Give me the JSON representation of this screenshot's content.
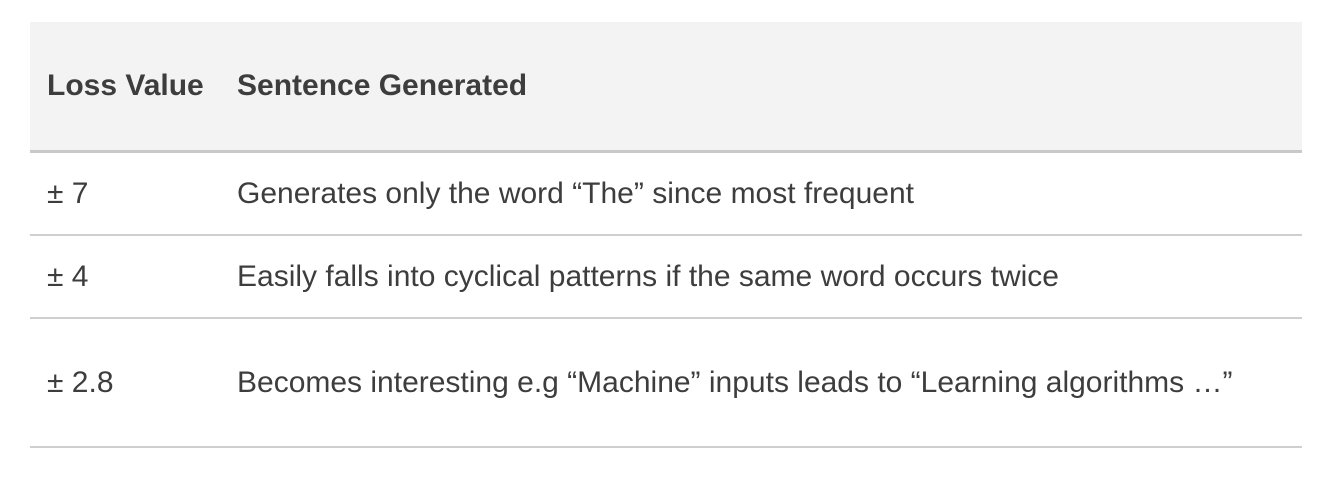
{
  "table": {
    "headers": {
      "loss": "Loss Value",
      "sentence": "Sentence Generated"
    },
    "rows": [
      {
        "loss": "± 7",
        "sentence": "Generates only the word “The” since most frequent"
      },
      {
        "loss": "± 4",
        "sentence": "Easily falls into cyclical patterns if the same word occurs twice"
      },
      {
        "loss": "± 2.8",
        "sentence": "Becomes interesting e.g “Machine” inputs leads to “Learning algorithms …”"
      }
    ]
  }
}
